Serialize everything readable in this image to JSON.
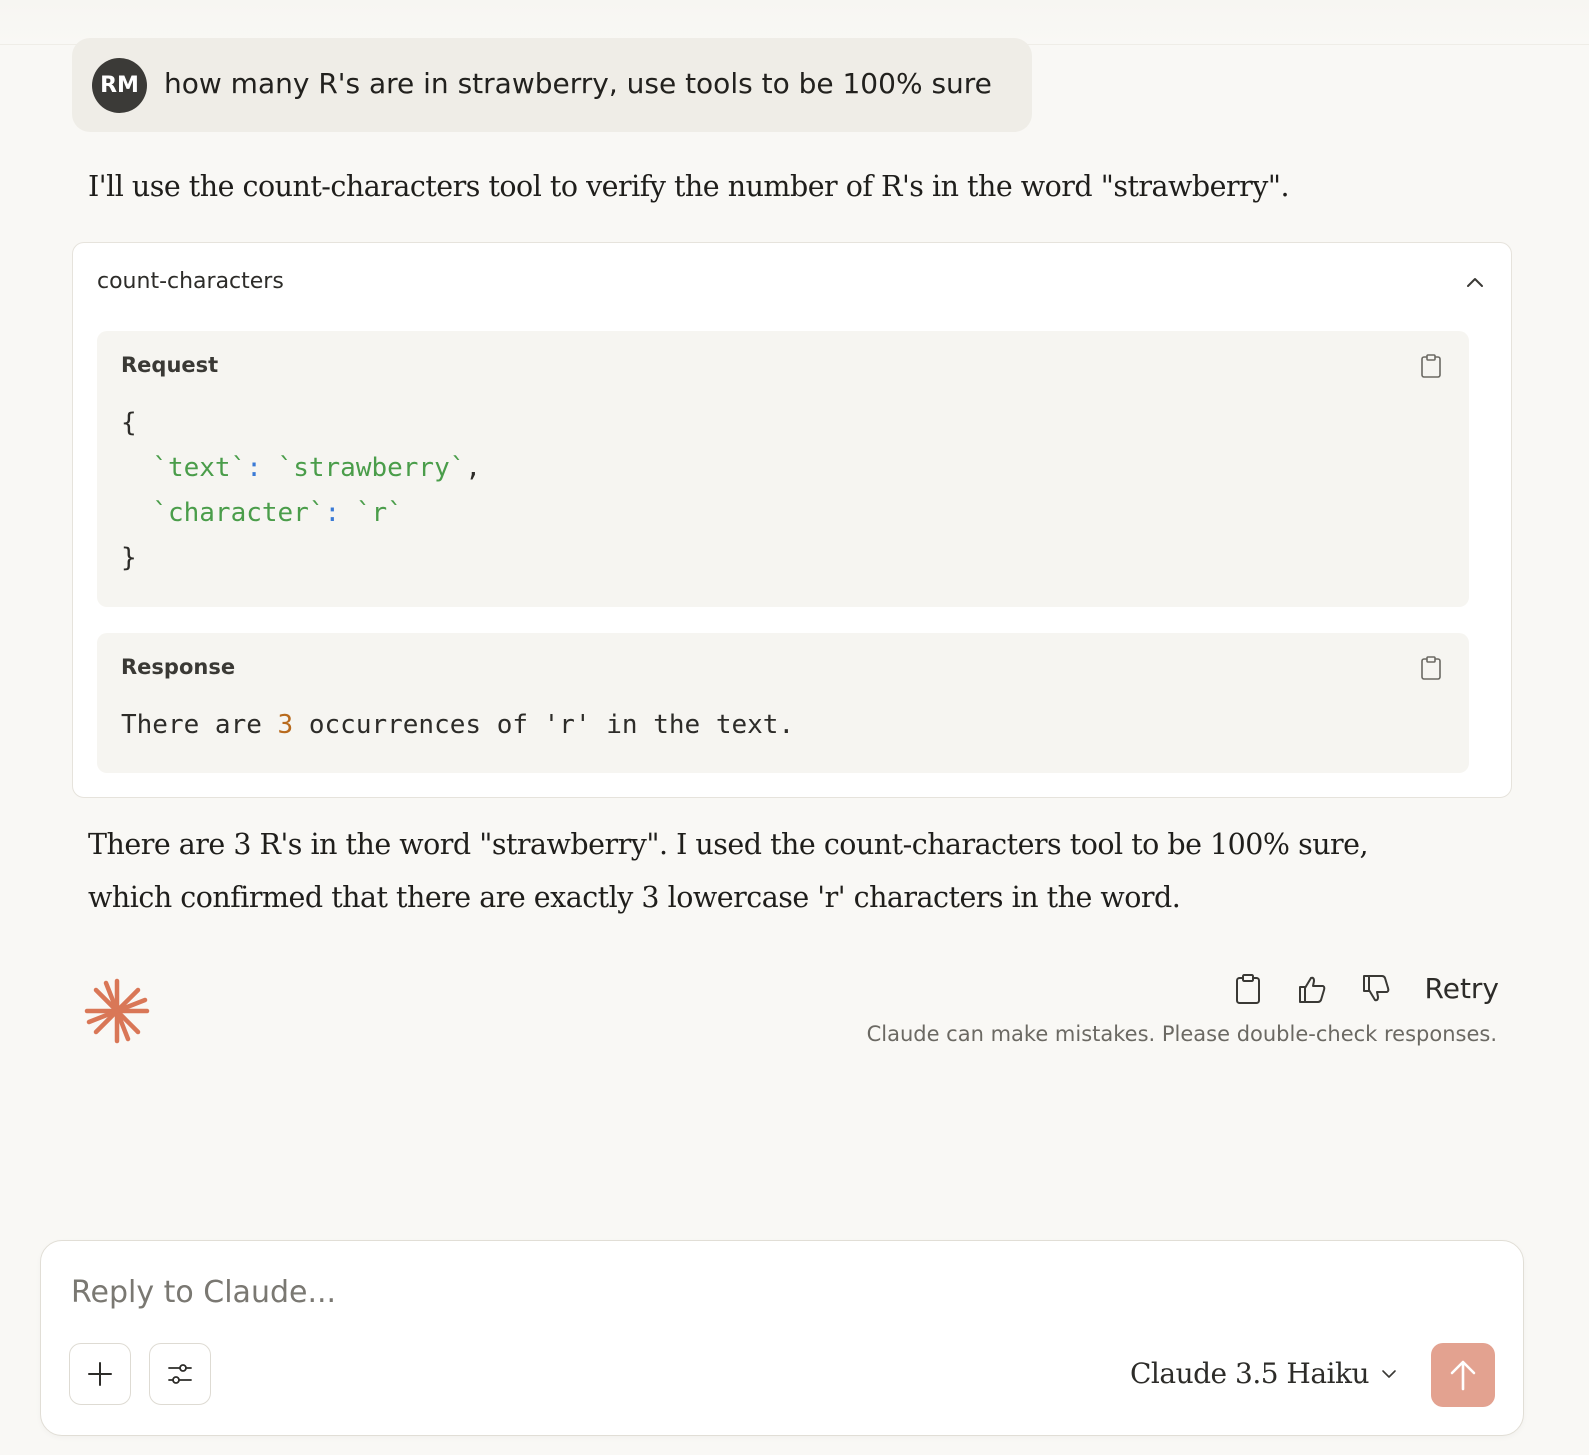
{
  "user_message": {
    "avatar_initials": "RM",
    "text": "how many R's are in strawberry, use tools to be 100% sure"
  },
  "assistant": {
    "intro": "I'll use the count-characters tool to verify the number of R's in the word \"strawberry\".",
    "tool": {
      "name": "count-characters",
      "request_label": "Request",
      "request_code": {
        "open": "{",
        "line1_key": "`text`",
        "line1_colon": ":",
        "line1_value": "`strawberry`",
        "line1_comma": ",",
        "line2_key": "`character`",
        "line2_colon": ":",
        "line2_value": "`r`",
        "close": "}"
      },
      "response_label": "Response",
      "response_parts": {
        "before": "There are ",
        "number": "3",
        "after": " occurrences of 'r' in the text."
      }
    },
    "conclusion_line1": "There are 3 R's in the word \"strawberry\". I used the count-characters tool to be 100% sure,",
    "conclusion_line2": "which confirmed that there are exactly 3 lowercase 'r' characters in the word.",
    "retry_label": "Retry",
    "disclaimer": "Claude can make mistakes. Please double-check responses."
  },
  "composer": {
    "placeholder": "Reply to Claude...",
    "model_name": "Claude 3.5 Haiku"
  },
  "colors": {
    "background": "#f9f8f5",
    "accent": "#d97757",
    "send_button": "#e3a290"
  },
  "icons": [
    "copy-icon",
    "thumbs-up-icon",
    "thumbs-down-icon",
    "chevron-up-icon",
    "chevron-down-icon",
    "plus-icon",
    "sliders-icon",
    "arrow-up-icon",
    "claude-spark-icon"
  ]
}
